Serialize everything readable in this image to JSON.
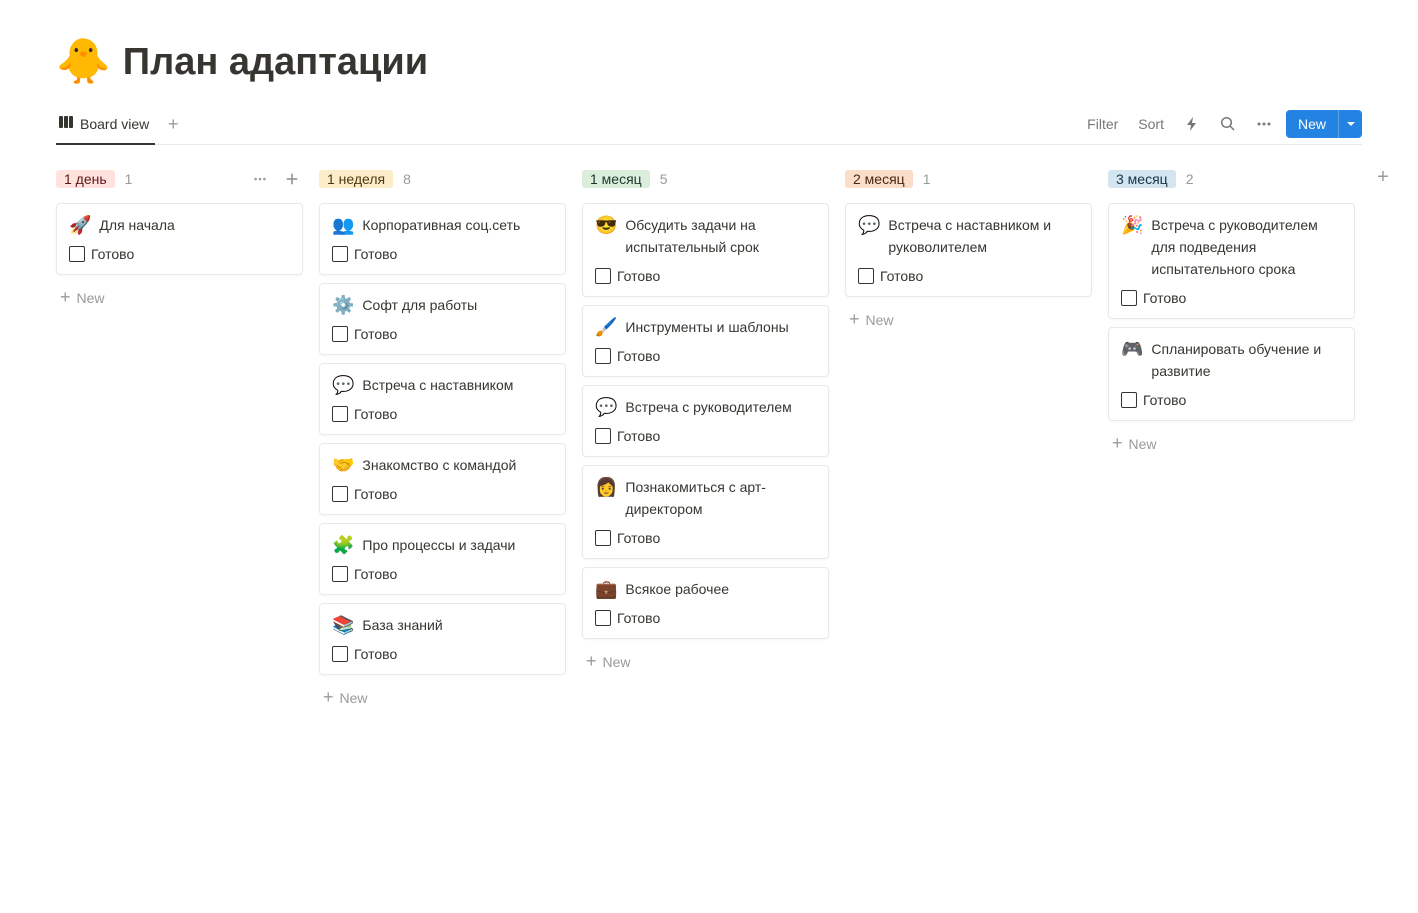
{
  "page": {
    "icon": "🐥",
    "title": "План адаптации"
  },
  "view": {
    "active_tab_label": "Board view"
  },
  "toolbar": {
    "filter_label": "Filter",
    "sort_label": "Sort",
    "new_label": "New"
  },
  "common": {
    "new_card_label": "New",
    "checkbox_label": "Готово"
  },
  "columns": [
    {
      "name": "1 день",
      "tag_class": "tag-red",
      "count": "1",
      "show_controls": true,
      "cards": [
        {
          "emoji": "🚀",
          "title": "Для начала"
        }
      ]
    },
    {
      "name": "1 неделя",
      "tag_class": "tag-yellow",
      "count": "8",
      "show_controls": false,
      "cards": [
        {
          "emoji": "👥",
          "title": "Корпоративная соц.сеть"
        },
        {
          "emoji": "⚙️",
          "title": "Софт для работы"
        },
        {
          "emoji": "💬",
          "title": "Встреча с наставником"
        },
        {
          "emoji": "🤝",
          "title": "Знакомство с командой"
        },
        {
          "emoji": "🧩",
          "title": "Про процессы и задачи"
        },
        {
          "emoji": "📚",
          "title": "База знаний"
        }
      ]
    },
    {
      "name": "1 месяц",
      "tag_class": "tag-green",
      "count": "5",
      "show_controls": false,
      "cards": [
        {
          "emoji": "😎",
          "title": "Обсудить задачи на испытательный срок"
        },
        {
          "emoji": "🖌️",
          "title": "Инструменты и шаблоны"
        },
        {
          "emoji": "💬",
          "title": "Встреча с руководителем"
        },
        {
          "emoji": "👩",
          "title": "Познакомиться с арт-директором"
        },
        {
          "emoji": "💼",
          "title": "Всякое рабочее"
        }
      ]
    },
    {
      "name": "2 месяц",
      "tag_class": "tag-orange",
      "count": "1",
      "show_controls": false,
      "cards": [
        {
          "emoji": "💬",
          "title": "Встреча с наставником и руковолителем"
        }
      ]
    },
    {
      "name": "3 месяц",
      "tag_class": "tag-blue",
      "count": "2",
      "show_controls": false,
      "cards": [
        {
          "emoji": "🎉",
          "title": "Встреча с руководителем для подведения испытательного срока"
        },
        {
          "emoji": "🎮",
          "title": "Спланировать обучение и развитие"
        }
      ]
    }
  ]
}
